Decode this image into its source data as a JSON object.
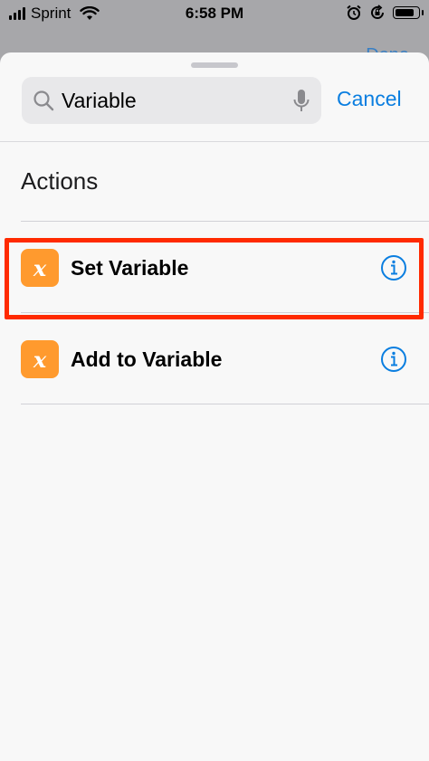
{
  "status_bar": {
    "carrier": "Sprint",
    "time": "6:58 PM",
    "battery_level": 0.85
  },
  "background": {
    "done_label": "Done"
  },
  "search": {
    "value": "Variable",
    "cancel_label": "Cancel"
  },
  "section": {
    "title": "Actions"
  },
  "actions": [
    {
      "label": "Set Variable",
      "icon_glyph": "x",
      "icon": "variable-icon",
      "highlighted": true
    },
    {
      "label": "Add to Variable",
      "icon_glyph": "x",
      "icon": "variable-icon",
      "highlighted": false
    }
  ],
  "colors": {
    "accent": "#0a7ee0",
    "icon_bg": "#ff9a2e",
    "highlight": "#ff2a00"
  }
}
